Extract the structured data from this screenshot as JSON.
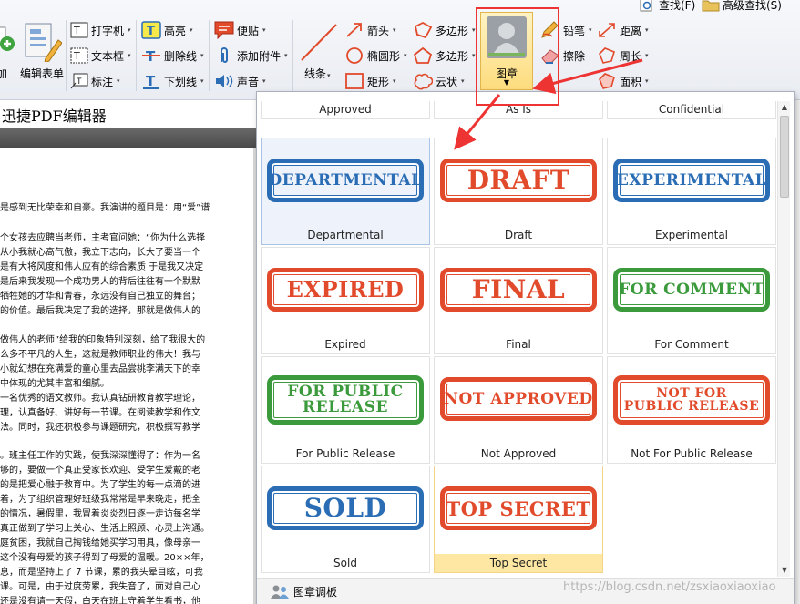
{
  "top_bar": {
    "find": "查找(F)",
    "advanced_find": "高级查找(S)"
  },
  "ribbon": {
    "add_fragment": "加",
    "edit_form": "编辑表单",
    "typewriter": "打字机",
    "textbox": "文本框",
    "callout": "标注",
    "highlight": "高亮",
    "strikeout": "删除线",
    "underline": "下划线",
    "note": "便贴",
    "attach_file": "添加附件",
    "sound": "声音",
    "line": "线条",
    "arrow": "箭头",
    "ellipse": "椭圆形",
    "rectangle": "矩形",
    "polygon": "多边形",
    "polyline": "多边形",
    "cloud": "云状",
    "stamp": "图章",
    "pencil": "铅笔",
    "eraser": "擦除",
    "distance": "距离",
    "perimeter": "周长",
    "area": "面积"
  },
  "document": {
    "title": "迅捷PDF编辑器",
    "lines": [
      "是感到无比荣幸和自豪。我演讲的题目是：用“爱”谱",
      "",
      "个女孩去应聘当老师，主考官问她：“你为什么选择",
      "从小我就心高气傲，我立下志向，长大了要当一个",
      "是有大将风度和伟人应有的综合素质 于是我又决定",
      "是后来我发现一个成功男人的背后往往有一个默默",
      "牺牲她的才华和青春，永远没有自己独立的舞台；",
      "的价值。最后我决定了我的选择，那就是做伟人的",
      "",
      "做伟人的老师”给我的印象特别深刻，给了我很大的",
      "么多不平凡的人生，这就是教师职业的伟大！我与",
      "小就幻想在充满爱的童心里去品尝桃李满天下的幸",
      "中体现的尤其丰富和细腻。",
      "一名优秀的语文教师。我认真钻研教育教学理论，",
      "理，认真备好、讲好每一节课。在阅读教学和作文",
      "法。同时，我还积极参与课题研究，积极撰写教学",
      "",
      "。班主任工作的实践，使我深深懂得了：作为一名",
      "够的，要做一个真正受家长欢迎、受学生爱戴的老",
      "的是把爱心融于教育中。为了学生的每一点滴的进",
      "着，为了组织管理好班级我常常是早来晚走，把全",
      "的情况，暑假里，我冒着炎炎烈日逐一走访每名学",
      "真正做到了学习上关心、生活上照顾、心灵上沟通。",
      "庭贫困，我就自己掏钱给她买学习用具，像母亲一",
      "这个没有母爱的孩子得到了母爱的温暖。20××年，",
      "息，而是坚持上了 7 节课，累的我头晕目眩，可我",
      "课。可是，由于过度劳累，我失音了，面对自己心",
      "还是没有请一天假，白天在班上守着学生看书，他"
    ]
  },
  "stamp_panel": {
    "stamps": [
      {
        "label": "Approved",
        "text": "",
        "color": "#2f6fb3"
      },
      {
        "label": "As Is",
        "text": "",
        "color": "#e0442c"
      },
      {
        "label": "Confidential",
        "text": "",
        "color": "#2f6fb3"
      },
      {
        "label": "Departmental",
        "text": "DEPARTMENTAL",
        "color": "#2a6db5"
      },
      {
        "label": "Draft",
        "text": "DRAFT",
        "color": "#e24a2c"
      },
      {
        "label": "Experimental",
        "text": "EXPERIMENTAL",
        "color": "#2a6db5"
      },
      {
        "label": "Expired",
        "text": "EXPIRED",
        "color": "#e24a2c"
      },
      {
        "label": "Final",
        "text": "FINAL",
        "color": "#e24a2c"
      },
      {
        "label": "For Comment",
        "text": "FOR COMMENT",
        "color": "#3b9a3b"
      },
      {
        "label": "For Public Release",
        "text": "FOR PUBLIC\nRELEASE",
        "color": "#3b9a3b"
      },
      {
        "label": "Not Approved",
        "text": "NOT APPROVED",
        "color": "#e24a2c"
      },
      {
        "label": "Not For Public Release",
        "text": "NOT FOR\nPUBLIC RELEASE",
        "color": "#e24a2c"
      },
      {
        "label": "Sold",
        "text": "SOLD",
        "color": "#2a6db5"
      },
      {
        "label": "Top Secret",
        "text": "TOP SECRET",
        "color": "#e24a2c"
      }
    ],
    "footer_label": "图章调板"
  },
  "watermark": "https://blog.csdn.net/zsxiaoxiaoxiao",
  "colors": {
    "annotation_red": "#ee3333",
    "selection_yellow": "#fde7a2",
    "selection_blue": "#eef3fb"
  }
}
